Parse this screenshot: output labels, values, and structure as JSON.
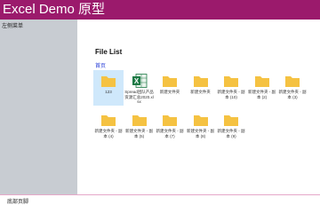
{
  "header": {
    "title": "Excel Demo 原型"
  },
  "sidebar": {
    "label": "左侧菜单"
  },
  "main": {
    "heading": "File List",
    "breadcrumb": "首页",
    "items": [
      {
        "label": "123",
        "icon": "folder-icon",
        "selected": true
      },
      {
        "label": "Spread团队产品资源汇总2020.xlsx",
        "icon": "excel-file-icon",
        "selected": false
      },
      {
        "label": "新建文件夹",
        "icon": "folder-icon",
        "selected": false
      },
      {
        "label": "新建文件夹",
        "icon": "folder-icon",
        "selected": false
      },
      {
        "label": "新建文件夹 - 副本 (10)",
        "icon": "folder-icon",
        "selected": false
      },
      {
        "label": "新建文件夹 - 副本 (2)",
        "icon": "folder-icon",
        "selected": false
      },
      {
        "label": "新建文件夹 - 副本 (3)",
        "icon": "folder-icon",
        "selected": false
      },
      {
        "label": "新建文件夹 - 副本 (4)",
        "icon": "folder-icon",
        "selected": false
      },
      {
        "label": "新建文件夹 - 副本 (5)",
        "icon": "folder-icon",
        "selected": false
      },
      {
        "label": "新建文件夹 - 副本 (7)",
        "icon": "folder-icon",
        "selected": false
      },
      {
        "label": "新建文件夹 - 副本 (8)",
        "icon": "folder-icon",
        "selected": false
      },
      {
        "label": "新建文件夹 - 副本 (9)",
        "icon": "folder-icon",
        "selected": false
      }
    ]
  },
  "footer": {
    "label": "底部页脚"
  },
  "colors": {
    "header": "#9b1a6c",
    "sidebar": "#c8ccd2",
    "folder": "#f5c242",
    "excel": "#1d7a45",
    "link": "#2a3fd8",
    "selected": "#cfe8fb"
  }
}
